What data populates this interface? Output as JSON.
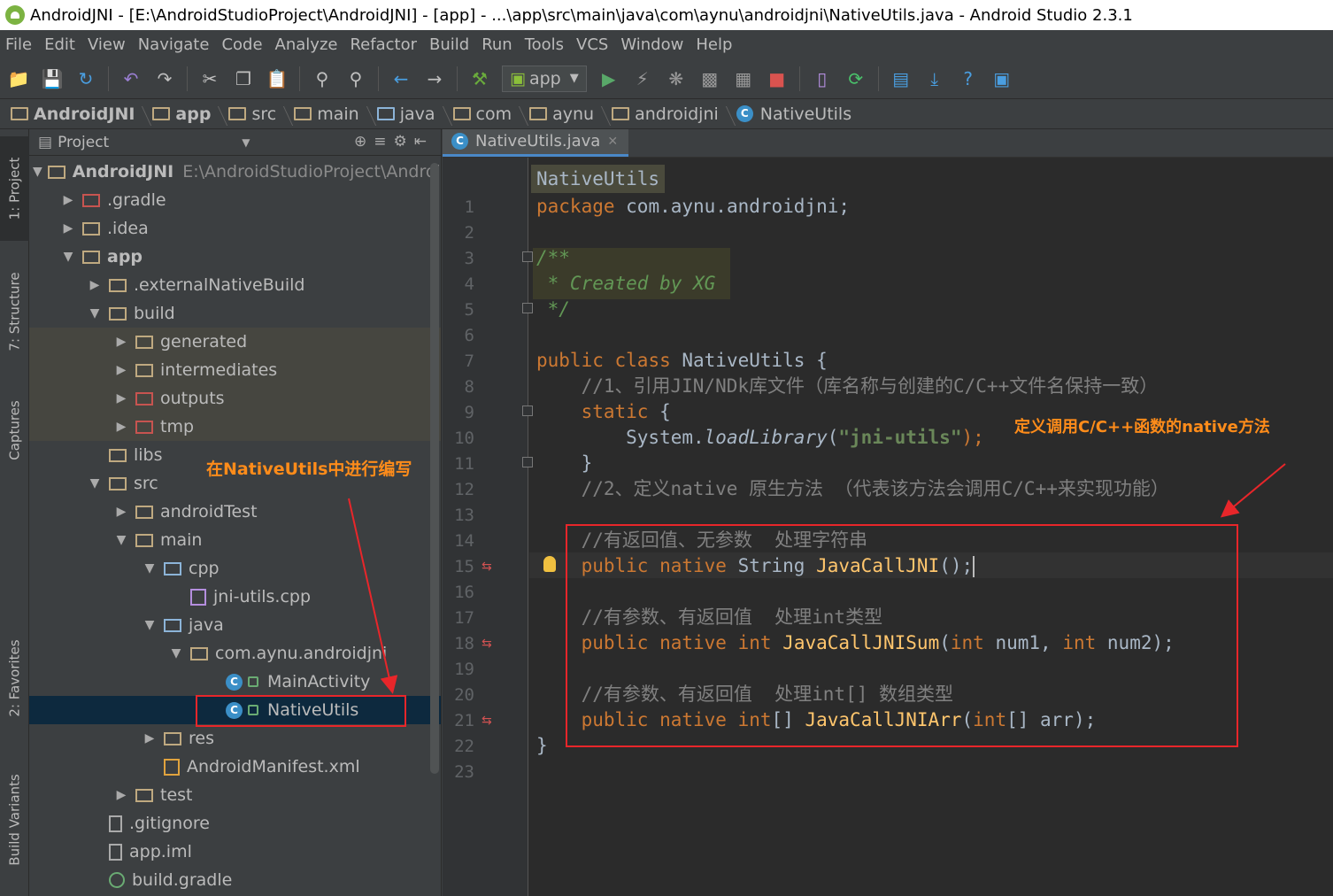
{
  "window": {
    "title": "AndroidJNI - [E:\\AndroidStudioProject\\AndroidJNI] - [app] - ...\\app\\src\\main\\java\\com\\aynu\\androidjni\\NativeUtils.java - Android Studio 2.3.1"
  },
  "menu": {
    "items": [
      "File",
      "Edit",
      "View",
      "Navigate",
      "Code",
      "Analyze",
      "Refactor",
      "Build",
      "Run",
      "Tools",
      "VCS",
      "Window",
      "Help"
    ]
  },
  "toolbar": {
    "run_config": "app",
    "icons": [
      "open-folder-icon",
      "save-icon",
      "sync-icon",
      "undo-icon",
      "redo-icon",
      "cut-icon",
      "copy-icon",
      "paste-icon",
      "find-icon",
      "replace-icon",
      "back-icon",
      "forward-icon",
      "build-icon",
      "run-icon",
      "apply-changes-icon",
      "debug-icon",
      "attach-debugger-icon",
      "profile-icon",
      "stop-icon",
      "avd-manager-icon",
      "sync-gradle-icon",
      "project-structure-icon",
      "sdk-manager-icon",
      "help-icon",
      "translate-icon"
    ]
  },
  "breadcrumb": [
    "AndroidJNI",
    "app",
    "src",
    "main",
    "java",
    "com",
    "aynu",
    "androidjni",
    "NativeUtils"
  ],
  "left_strip": {
    "tabs": [
      "1: Project",
      "7: Structure",
      "Captures",
      "2: Favorites",
      "Build Variants"
    ]
  },
  "project_panel": {
    "header": "Project",
    "tree": [
      {
        "label": "AndroidJNI",
        "path": "E:\\AndroidStudioProject\\Android",
        "bold": true,
        "icon": "module"
      },
      {
        "label": ".gradle",
        "icon": "folder-red"
      },
      {
        "label": ".idea",
        "icon": "folder"
      },
      {
        "label": "app",
        "bold": true,
        "icon": "module"
      },
      {
        "label": ".externalNativeBuild",
        "icon": "folder"
      },
      {
        "label": "build",
        "icon": "folder"
      },
      {
        "label": "generated",
        "icon": "folder"
      },
      {
        "label": "intermediates",
        "icon": "folder"
      },
      {
        "label": "outputs",
        "icon": "folder-red"
      },
      {
        "label": "tmp",
        "icon": "folder-red"
      },
      {
        "label": "libs",
        "icon": "folder"
      },
      {
        "label": "src",
        "icon": "folder"
      },
      {
        "label": "androidTest",
        "icon": "folder"
      },
      {
        "label": "main",
        "icon": "folder"
      },
      {
        "label": "cpp",
        "icon": "folder-blue"
      },
      {
        "label": "jni-utils.cpp",
        "icon": "cpp-file"
      },
      {
        "label": "java",
        "icon": "folder-blue"
      },
      {
        "label": "com.aynu.androidjni",
        "icon": "package"
      },
      {
        "label": "MainActivity",
        "icon": "class"
      },
      {
        "label": "NativeUtils",
        "icon": "class"
      },
      {
        "label": "res",
        "icon": "folder-res"
      },
      {
        "label": "AndroidManifest.xml",
        "icon": "xml-file"
      },
      {
        "label": "test",
        "icon": "folder"
      },
      {
        "label": ".gitignore",
        "icon": "file"
      },
      {
        "label": "app.iml",
        "icon": "file"
      },
      {
        "label": "build.gradle",
        "icon": "gradle-file"
      }
    ]
  },
  "editor": {
    "tab": "NativeUtils.java",
    "class_popup": "NativeUtils",
    "line_numbers": [
      "1",
      "2",
      "3",
      "4",
      "5",
      "6",
      "7",
      "8",
      "9",
      "10",
      "11",
      "12",
      "13",
      "14",
      "15",
      "16",
      "17",
      "18",
      "19",
      "20",
      "21",
      "22",
      "23"
    ],
    "lines": {
      "l1": [
        "package",
        " com.aynu.androidjni;"
      ],
      "l3": "/**",
      "l4": " * Created by XG",
      "l5": " */",
      "l7": [
        "public",
        " ",
        "class",
        " NativeUtils {"
      ],
      "l8": "    //1、引用JIN/NDk库文件（库名称与创建的C/C++文件名保持一致）",
      "l9": [
        "    ",
        "static",
        " {"
      ],
      "l10": [
        "        System.",
        "loadLibrary",
        "(",
        "\"jni-utils\"",
        ");"
      ],
      "l11": "    }",
      "l12": "    //2、定义native 原生方法 （代表该方法会调用C/C++来实现功能）",
      "l14": "    //有返回值、无参数  处理字符串",
      "l15": [
        "    ",
        "public",
        " ",
        "native",
        " String ",
        "JavaCallJNI",
        "();"
      ],
      "l17": "    //有参数、有返回值  处理int类型",
      "l18": [
        "    ",
        "public",
        " ",
        "native",
        " ",
        "int",
        " ",
        "JavaCallJNISum",
        "(",
        "int",
        " num1, ",
        "int",
        " num2);"
      ],
      "l20": "    //有参数、有返回值  处理int[] 数组类型",
      "l21": [
        "    ",
        "public",
        " ",
        "native",
        " ",
        "int",
        "[] ",
        "JavaCallJNIArr",
        "(",
        "int",
        "[] arr);"
      ],
      "l22": "}"
    }
  },
  "annotations": {
    "left": "在NativeUtils中进行编写",
    "right": "定义调用C/C++函数的native方法"
  },
  "colors": {
    "annotation_text": "#ff8c1a",
    "annotation_box": "#e8262a",
    "keyword": "#cc7832",
    "comment": "#808080",
    "doc_comment": "#629755",
    "string": "#6a8759",
    "method": "#ffc66d"
  }
}
